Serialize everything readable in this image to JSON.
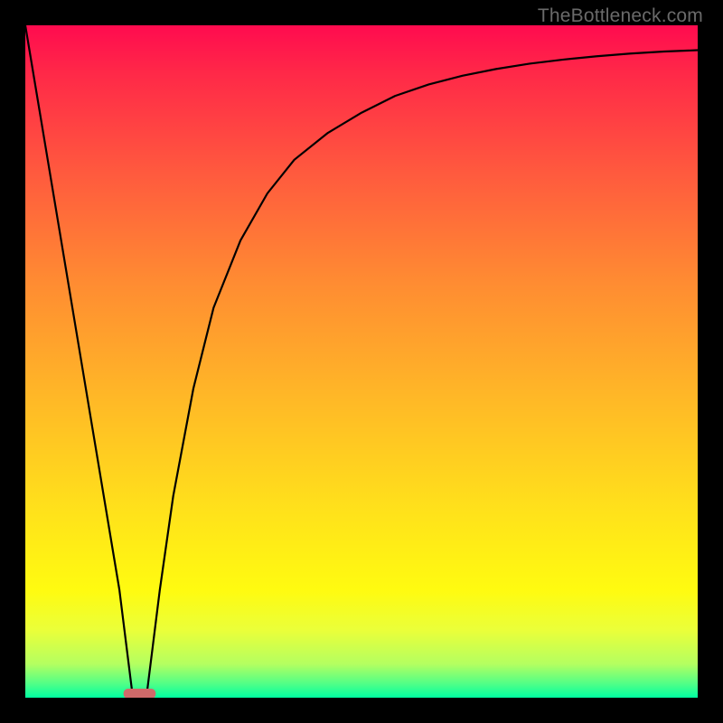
{
  "watermark": {
    "text": "TheBottleneck.com"
  },
  "chart_data": {
    "type": "line",
    "title": "",
    "xlabel": "",
    "ylabel": "",
    "xlim": [
      0,
      100
    ],
    "ylim": [
      0,
      100
    ],
    "grid": false,
    "legend": false,
    "series": [
      {
        "name": "bottleneck-curve",
        "x": [
          0,
          2,
          4,
          6,
          8,
          10,
          12,
          14,
          15,
          16,
          17,
          18,
          19,
          20,
          22,
          25,
          28,
          32,
          36,
          40,
          45,
          50,
          55,
          60,
          65,
          70,
          75,
          80,
          85,
          90,
          95,
          100
        ],
        "y": [
          100,
          88,
          76,
          64,
          52,
          40,
          28,
          16,
          8,
          0,
          0,
          0,
          8,
          16,
          30,
          46,
          58,
          68,
          75,
          80,
          84,
          87,
          89.5,
          91.2,
          92.5,
          93.5,
          94.3,
          94.9,
          95.4,
          95.8,
          96.1,
          96.3
        ]
      }
    ],
    "marker": {
      "name": "optimal-point",
      "x_center": 17,
      "x_halfwidth": 2.4,
      "color": "#cf6a6a"
    },
    "background_gradient": {
      "stops": [
        {
          "pos": 0.0,
          "color": "#ff0b4f"
        },
        {
          "pos": 0.07,
          "color": "#ff2848"
        },
        {
          "pos": 0.22,
          "color": "#ff5a3e"
        },
        {
          "pos": 0.38,
          "color": "#ff8b32"
        },
        {
          "pos": 0.55,
          "color": "#ffb727"
        },
        {
          "pos": 0.72,
          "color": "#ffe11b"
        },
        {
          "pos": 0.84,
          "color": "#fffb10"
        },
        {
          "pos": 0.9,
          "color": "#eaff3a"
        },
        {
          "pos": 0.95,
          "color": "#b4ff60"
        },
        {
          "pos": 0.98,
          "color": "#4eff88"
        },
        {
          "pos": 1.0,
          "color": "#00ffa1"
        }
      ]
    }
  }
}
